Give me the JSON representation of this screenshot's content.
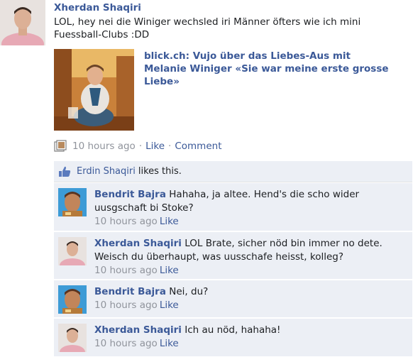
{
  "post": {
    "author": "Xherdan Shaqiri",
    "text": "LOL, hey nei die Winiger wechsled iri Männer öfters wie ich mini Fuessball-Clubs :DD",
    "share": {
      "title": "blick.ch: Vujo über das Liebes-Aus mit Melanie Winiger «Sie war meine erste grosse Liebe»"
    },
    "meta": {
      "time": "10 hours ago",
      "like_label": "Like",
      "comment_label": "Comment",
      "separator": "·"
    }
  },
  "likes": {
    "liker": "Erdin Shaqiri",
    "suffix": "likes this."
  },
  "comments": [
    {
      "author": "Bendrit Bajra",
      "text": "Hahaha, ja altee. Hend's die scho wider uusgschaft bi Stoke?",
      "time": "10 hours ago",
      "like_label": "Like"
    },
    {
      "author": "Xherdan Shaqiri",
      "text": "LOL Brate, sicher nöd bin immer no dete. Weisch du überhaupt, was uusschafe heisst, kolleg?",
      "time": "10 hours ago",
      "like_label": "Like"
    },
    {
      "author": "Bendrit Bajra",
      "text": "Nei, du?",
      "time": "10 hours ago",
      "like_label": "Like"
    },
    {
      "author": "Xherdan Shaqiri",
      "text": "Ich au nöd, hahaha!",
      "time": "10 hours ago",
      "like_label": "Like"
    }
  ],
  "colors": {
    "link": "#3b5998",
    "meta_gray": "#90949c",
    "comment_bg": "#eceff5"
  }
}
